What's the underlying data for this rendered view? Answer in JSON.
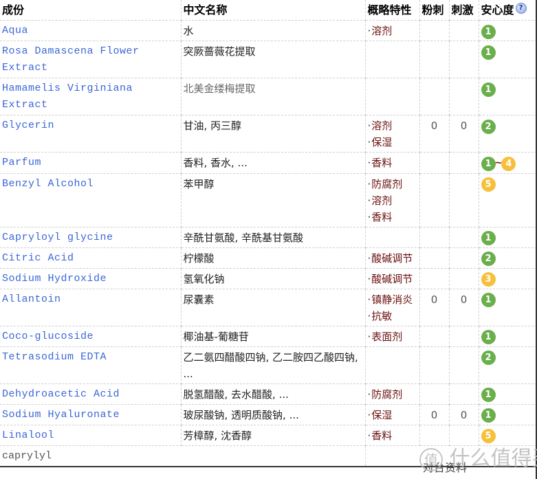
{
  "headers": {
    "ingredient": "成份",
    "chinese_name": "中文名称",
    "features": "概略特性",
    "acne": "粉刺",
    "irritation": "刺激",
    "safety": "安心度",
    "help_icon": "?"
  },
  "rows": [
    {
      "ingredient": "Aqua",
      "chinese": "水",
      "features": [
        "溶剂"
      ],
      "acne": "",
      "irritation": "",
      "safety": [
        {
          "v": "1",
          "c": "green"
        }
      ]
    },
    {
      "ingredient": "Rosa Damascena Flower Extract",
      "chinese": "突厥蔷薇花提取",
      "features": [],
      "acne": "",
      "irritation": "",
      "safety": [
        {
          "v": "1",
          "c": "green"
        }
      ]
    },
    {
      "ingredient": "Hamamelis Virginiana Extract",
      "chinese": "北美金缕梅提取",
      "features": [],
      "acne": "",
      "irritation": "",
      "safety": [
        {
          "v": "1",
          "c": "green"
        }
      ]
    },
    {
      "ingredient": "Glycerin",
      "chinese": "甘油, 丙三醇",
      "features": [
        "溶剂",
        "保湿"
      ],
      "acne": "0",
      "irritation": "0",
      "safety": [
        {
          "v": "2",
          "c": "green"
        }
      ]
    },
    {
      "ingredient": "Parfum",
      "chinese": "香料, 香水, ...",
      "features": [
        "香料"
      ],
      "acne": "",
      "irritation": "",
      "safety": [
        {
          "v": "1",
          "c": "green"
        },
        {
          "v": "4",
          "c": "yellow"
        }
      ]
    },
    {
      "ingredient": "Benzyl Alcohol",
      "chinese": "苯甲醇",
      "features": [
        "防腐剂",
        "溶剂",
        "香料"
      ],
      "acne": "",
      "irritation": "",
      "safety": [
        {
          "v": "5",
          "c": "yellow"
        }
      ]
    },
    {
      "ingredient": "Capryloyl glycine",
      "chinese": "辛酰甘氨酸, 辛酰基甘氨酸",
      "features": [],
      "acne": "",
      "irritation": "",
      "safety": [
        {
          "v": "1",
          "c": "green"
        }
      ]
    },
    {
      "ingredient": "Citric Acid",
      "chinese": "柠檬酸",
      "features": [
        "酸碱调节"
      ],
      "acne": "",
      "irritation": "",
      "safety": [
        {
          "v": "2",
          "c": "green"
        }
      ]
    },
    {
      "ingredient": "Sodium Hydroxide",
      "chinese": "氢氧化钠",
      "features": [
        "酸碱调节"
      ],
      "acne": "",
      "irritation": "",
      "safety": [
        {
          "v": "3",
          "c": "yellow"
        }
      ]
    },
    {
      "ingredient": "Allantoin",
      "chinese": "尿囊素",
      "features": [
        "镇静消炎",
        "抗敏"
      ],
      "acne": "0",
      "irritation": "0",
      "safety": [
        {
          "v": "1",
          "c": "green"
        }
      ]
    },
    {
      "ingredient": "Coco-glucoside",
      "chinese": "椰油基-葡糖苷",
      "features": [
        "表面剂"
      ],
      "acne": "",
      "irritation": "",
      "safety": [
        {
          "v": "1",
          "c": "green"
        }
      ]
    },
    {
      "ingredient": "Tetrasodium EDTA",
      "chinese": "乙二氨四醋酸四钠, 乙二胺四乙酸四钠, ...",
      "features": [],
      "acne": "",
      "irritation": "",
      "safety": [
        {
          "v": "2",
          "c": "green"
        }
      ]
    },
    {
      "ingredient": "Dehydroacetic Acid",
      "chinese": "脱氢醋酸, 去水醋酸, ...",
      "features": [
        "防腐剂"
      ],
      "acne": "",
      "irritation": "",
      "safety": [
        {
          "v": "1",
          "c": "green"
        }
      ]
    },
    {
      "ingredient": "Sodium Hyaluronate",
      "chinese": "玻尿酸钠, 透明质酸钠, ...",
      "features": [
        "保湿"
      ],
      "acne": "0",
      "irritation": "0",
      "safety": [
        {
          "v": "1",
          "c": "green"
        }
      ]
    },
    {
      "ingredient": "Linalool",
      "chinese": "芳樟醇, 沈香醇",
      "features": [
        "香料"
      ],
      "acne": "",
      "irritation": "",
      "safety": [
        {
          "v": "5",
          "c": "yellow"
        }
      ]
    }
  ],
  "last_row": {
    "unknown_ingredient": "caprylyl",
    "link_text": "对台资料"
  },
  "watermark": {
    "logo": "值",
    "text": "什么值得买"
  },
  "colors": {
    "safe_green": "#6aaf4b",
    "caution_yellow": "#f7c03c",
    "ingredient_link": "#3a66d6",
    "feature_text": "#6b1010"
  }
}
